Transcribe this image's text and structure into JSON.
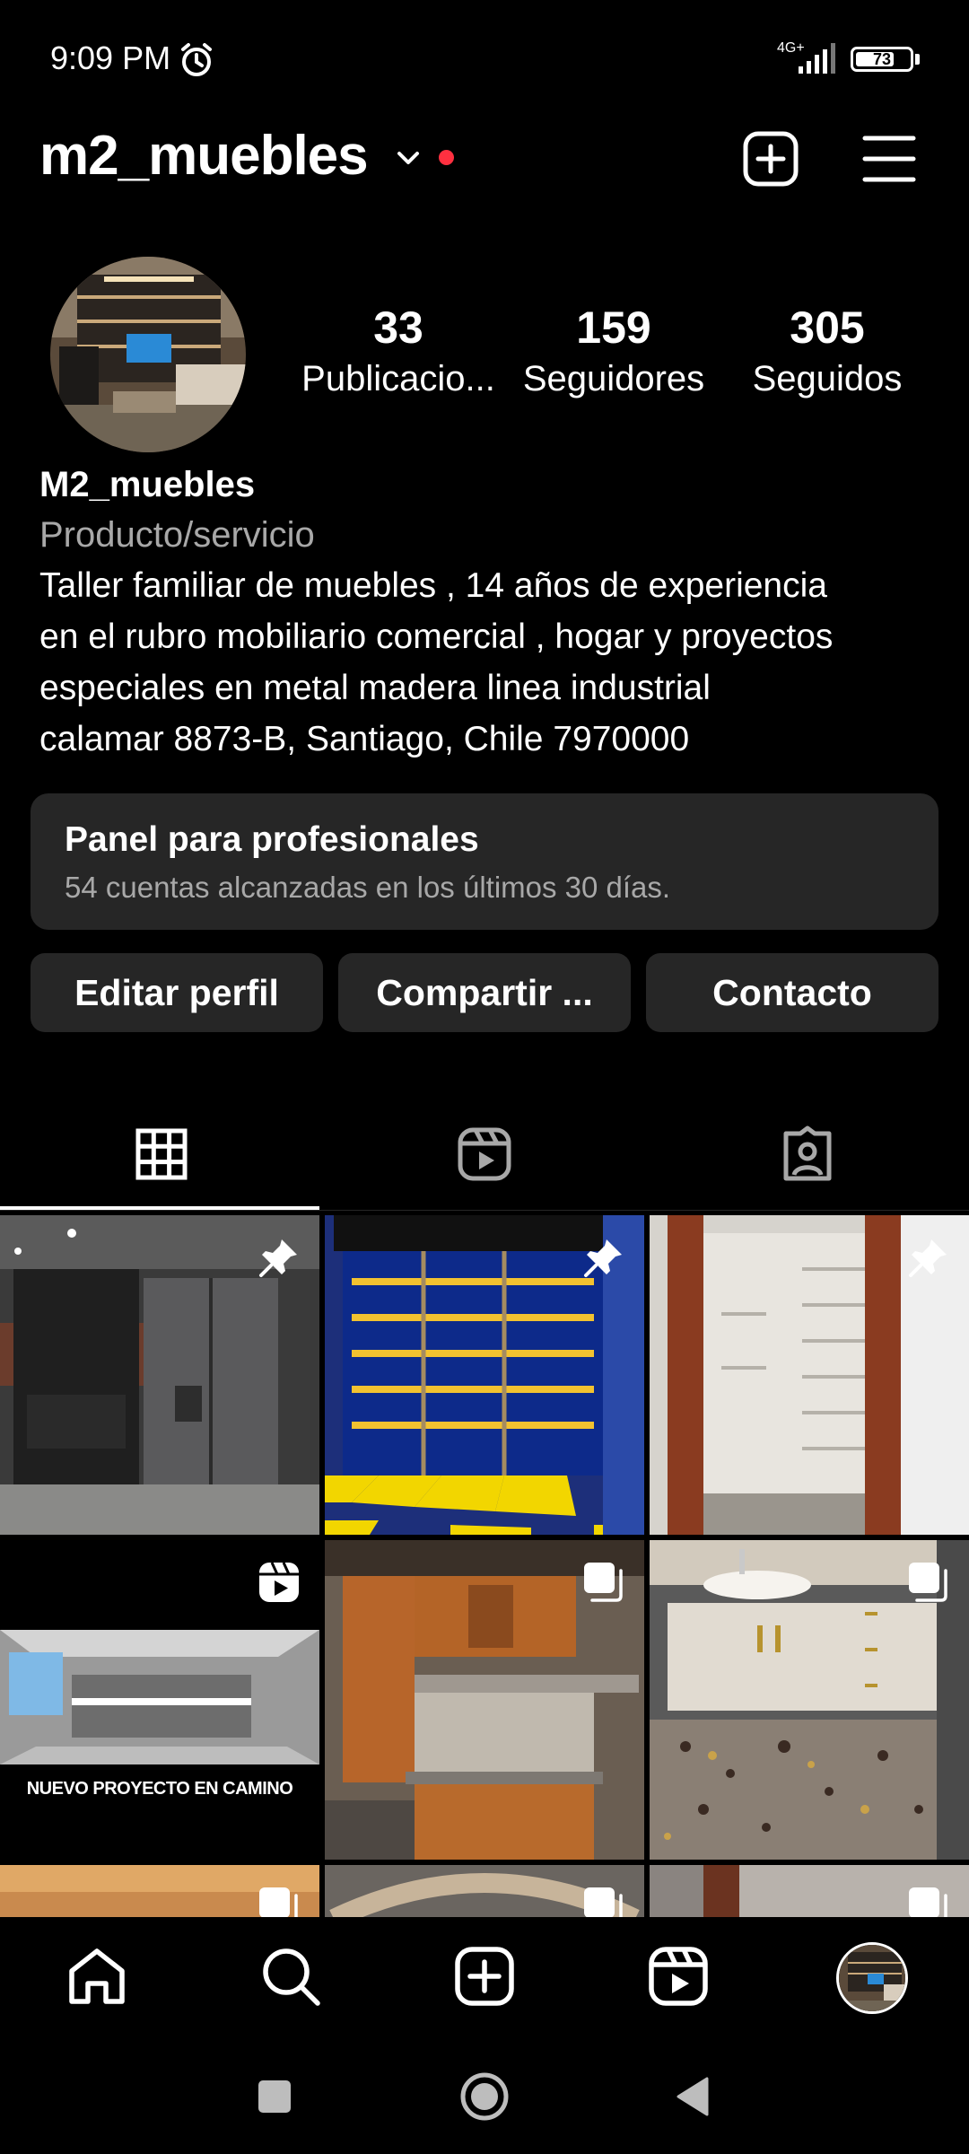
{
  "status_bar": {
    "time": "9:09 PM",
    "network": "4G+",
    "battery": "73",
    "battery_level": 0.73
  },
  "header": {
    "username": "m2_muebles",
    "notification_dot_color": "#ff3040"
  },
  "profile": {
    "stats": [
      {
        "value": "33",
        "label": "Publicacio..."
      },
      {
        "value": "159",
        "label": "Seguidores"
      },
      {
        "value": "305",
        "label": "Seguidos"
      }
    ],
    "display_name": "M2_muebles",
    "category": "Producto/servicio",
    "bio_lines": [
      "Taller familiar de muebles , 14 años de experiencia",
      "en el rubro mobiliario comercial , hogar y proyectos",
      "especiales en metal madera linea industrial",
      "calamar 8873-B, Santiago, Chile 7970000"
    ]
  },
  "pro_panel": {
    "title": "Panel para profesionales",
    "subtitle": "54 cuentas alcanzadas en los últimos 30 días."
  },
  "actions": {
    "edit": "Editar perfil",
    "share": "Compartir ...",
    "contact": "Contacto"
  },
  "tabs": [
    {
      "icon": "grid-icon",
      "active": true
    },
    {
      "icon": "reels-icon",
      "active": false
    },
    {
      "icon": "tagged-icon",
      "active": false
    }
  ],
  "posts": [
    {
      "subject": "kitchen-appliances",
      "badge": "pin-icon"
    },
    {
      "subject": "display-shelves",
      "badge": "pin-icon"
    },
    {
      "subject": "closet-shelves",
      "badge": "pin-icon"
    },
    {
      "subject": "kitchen-render",
      "badge": "reel-icon",
      "caption": "NUEVO PROYECTO EN CAMINO"
    },
    {
      "subject": "wood-kitchen",
      "badge": "carousel-icon"
    },
    {
      "subject": "bathroom-vanity",
      "badge": "carousel-icon"
    },
    {
      "subject": "wood-panel",
      "badge": "carousel-icon"
    },
    {
      "subject": "wood-arch",
      "badge": "carousel-icon"
    },
    {
      "subject": "door-frame",
      "badge": "carousel-icon"
    }
  ],
  "bottom_nav": [
    "home-icon",
    "search-icon",
    "create-icon",
    "reels-icon",
    "profile-avatar"
  ],
  "system_nav": [
    "recents-button",
    "home-button",
    "back-button"
  ]
}
